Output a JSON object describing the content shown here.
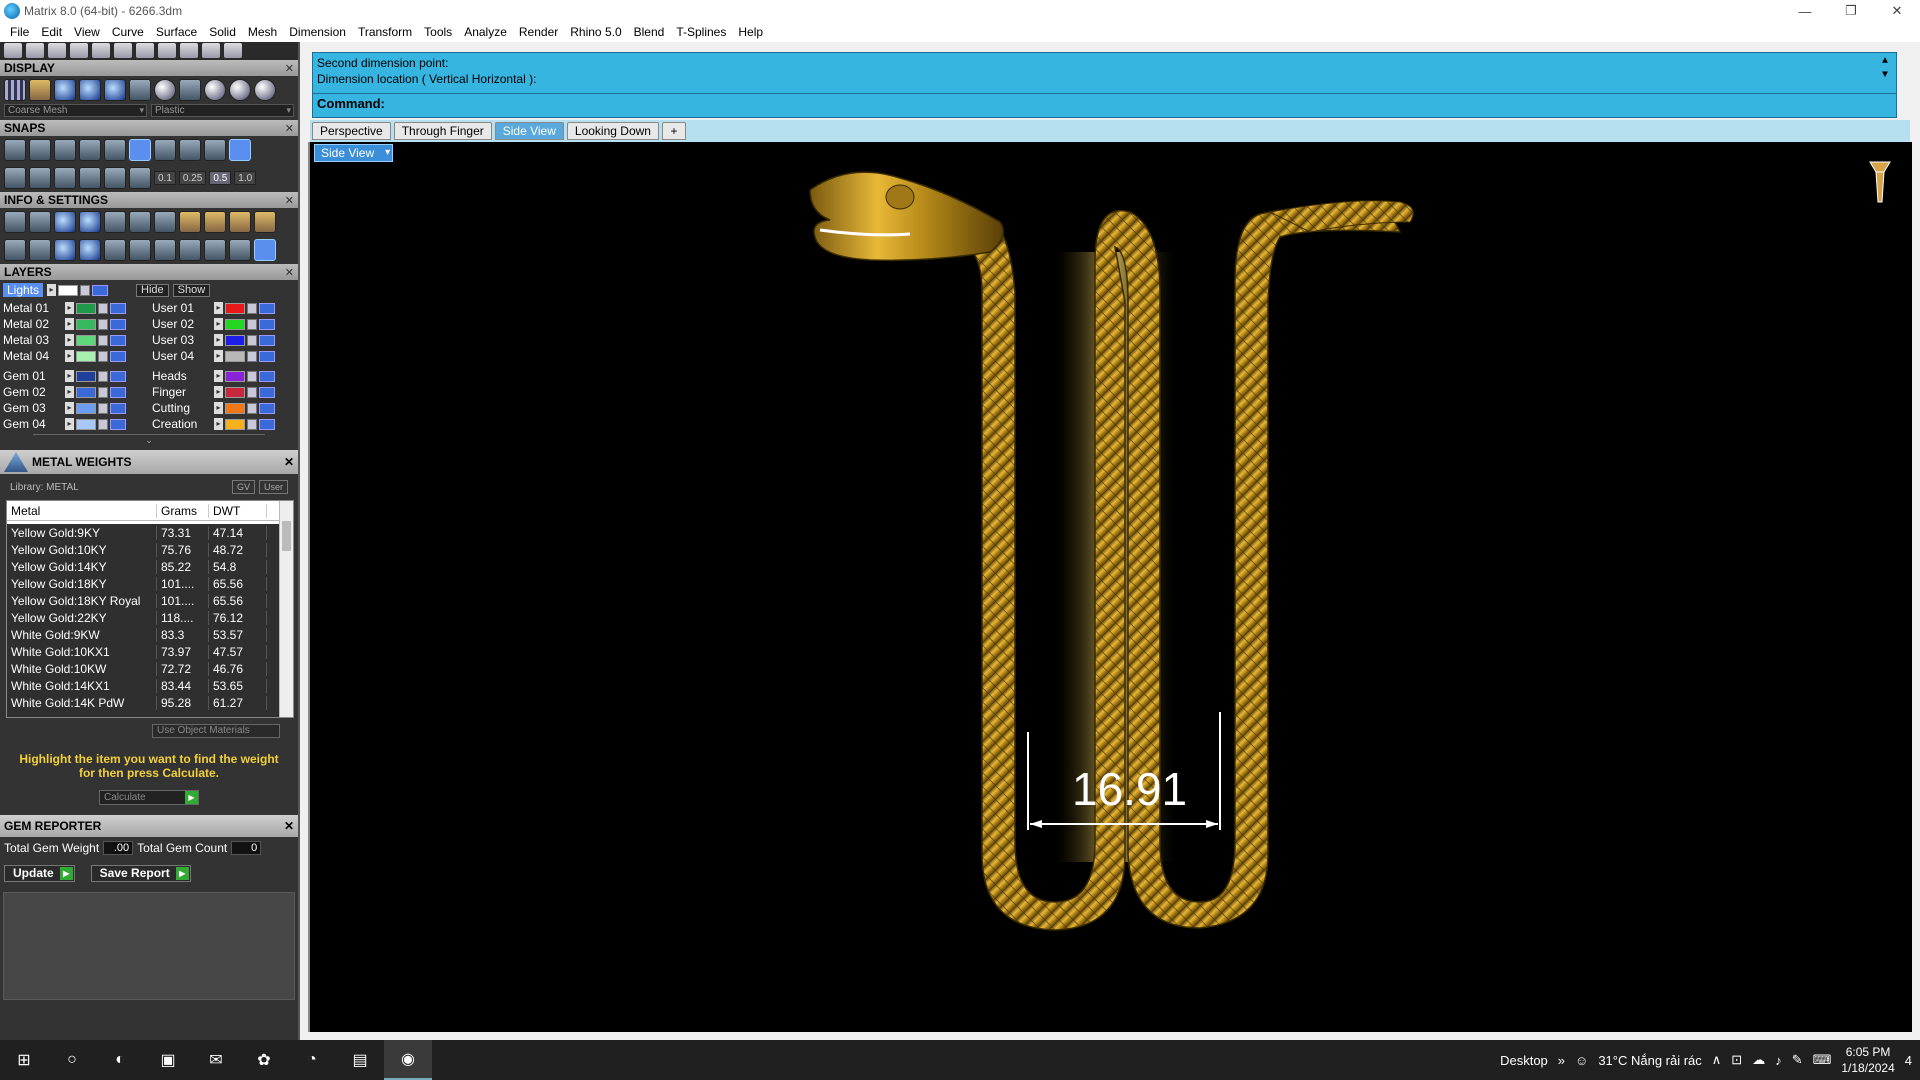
{
  "window": {
    "title": "Matrix 8.0 (64-bit) - 6266.3dm",
    "controls": [
      "—",
      "❐",
      "✕"
    ]
  },
  "menu": [
    "File",
    "Edit",
    "View",
    "Curve",
    "Surface",
    "Solid",
    "Mesh",
    "Dimension",
    "Transform",
    "Tools",
    "Analyze",
    "Render",
    "Rhino 5.0",
    "Blend",
    "T-Splines",
    "Help"
  ],
  "sections": {
    "display": "DISPLAY",
    "snaps": "SNAPS",
    "info": "INFO & SETTINGS",
    "layers": "LAYERS",
    "close_glyph": "✕"
  },
  "display": {
    "mesh": "Coarse Mesh",
    "material": "Plastic"
  },
  "snaps": {
    "values": [
      "0.1",
      "0.25",
      "0.5",
      "1.0"
    ],
    "selected": "0.5"
  },
  "layers": {
    "lights": "Lights",
    "hide": "Hide",
    "show": "Show",
    "left": [
      {
        "name": "Metal 01",
        "color": "#1f9a4a"
      },
      {
        "name": "Metal 02",
        "color": "#36b85e"
      },
      {
        "name": "Metal 03",
        "color": "#5ed87a"
      },
      {
        "name": "Metal 04",
        "color": "#a8f0b0"
      },
      {
        "name": "Gem 01",
        "color": "#1e3f9a"
      },
      {
        "name": "Gem 02",
        "color": "#3a6ad8"
      },
      {
        "name": "Gem 03",
        "color": "#6b9df0"
      },
      {
        "name": "Gem 04",
        "color": "#a8c8f8"
      }
    ],
    "right": [
      {
        "name": "User 01",
        "color": "#e8191b"
      },
      {
        "name": "User 02",
        "color": "#22d622"
      },
      {
        "name": "User 03",
        "color": "#1e1ee8"
      },
      {
        "name": "User 04",
        "color": "#b8b8b8"
      },
      {
        "name": "Heads",
        "color": "#8a22d8"
      },
      {
        "name": "Finger",
        "color": "#c8283c"
      },
      {
        "name": "Cutting",
        "color": "#f07818"
      },
      {
        "name": "Creation",
        "color": "#f5b21e"
      }
    ]
  },
  "metal_weights": {
    "title": "METAL WEIGHTS",
    "library": "Library: METAL",
    "toggle_gv": "GV",
    "toggle_user": "User",
    "headers": {
      "metal": "Metal",
      "grams": "Grams",
      "dwt": "DWT"
    },
    "rows": [
      {
        "metal": "Yellow Gold:9KY",
        "grams": "73.31",
        "dwt": "47.14"
      },
      {
        "metal": "Yellow Gold:10KY",
        "grams": "75.76",
        "dwt": "48.72"
      },
      {
        "metal": "Yellow Gold:14KY",
        "grams": "85.22",
        "dwt": "54.8"
      },
      {
        "metal": "Yellow Gold:18KY",
        "grams": "101....",
        "dwt": "65.56"
      },
      {
        "metal": "Yellow Gold:18KY Royal",
        "grams": "101....",
        "dwt": "65.56"
      },
      {
        "metal": "Yellow Gold:22KY",
        "grams": "118....",
        "dwt": "76.12"
      },
      {
        "metal": "White Gold:9KW",
        "grams": "83.3",
        "dwt": "53.57"
      },
      {
        "metal": "White Gold:10KX1",
        "grams": "73.97",
        "dwt": "47.57"
      },
      {
        "metal": "White Gold:10KW",
        "grams": "72.72",
        "dwt": "46.76"
      },
      {
        "metal": "White Gold:14KX1",
        "grams": "83.44",
        "dwt": "53.65"
      },
      {
        "metal": "White Gold:14K PdW",
        "grams": "95.28",
        "dwt": "61.27"
      }
    ],
    "use_object_materials": "Use Object Materials",
    "hint": "Highlight the item you want to find the weight for then press Calculate.",
    "calculate": "Calculate"
  },
  "gem_reporter": {
    "title": "GEM REPORTER",
    "total_weight_label": "Total Gem Weight",
    "total_weight": ".00",
    "total_count_label": "Total Gem Count",
    "total_count": "0",
    "update": "Update",
    "save_report": "Save Report"
  },
  "command": {
    "line1": "Second dimension point:",
    "line2": "Dimension location ( Vertical  Horizontal ):",
    "prompt": "Command:"
  },
  "tabs": [
    {
      "label": "Perspective",
      "active": false
    },
    {
      "label": "Through Finger",
      "active": false
    },
    {
      "label": "Side View",
      "active": true
    },
    {
      "label": "Looking Down",
      "active": false
    },
    {
      "label": "+",
      "active": false
    }
  ],
  "viewport": {
    "label": "Side View",
    "dimension": "16.91",
    "model_color": "#d4a325"
  },
  "taskbar": {
    "desktop": "Desktop",
    "weather": "31°C  Nắng rải rác",
    "time": "6:05 PM",
    "date": "1/18/2024",
    "notif": "4"
  }
}
